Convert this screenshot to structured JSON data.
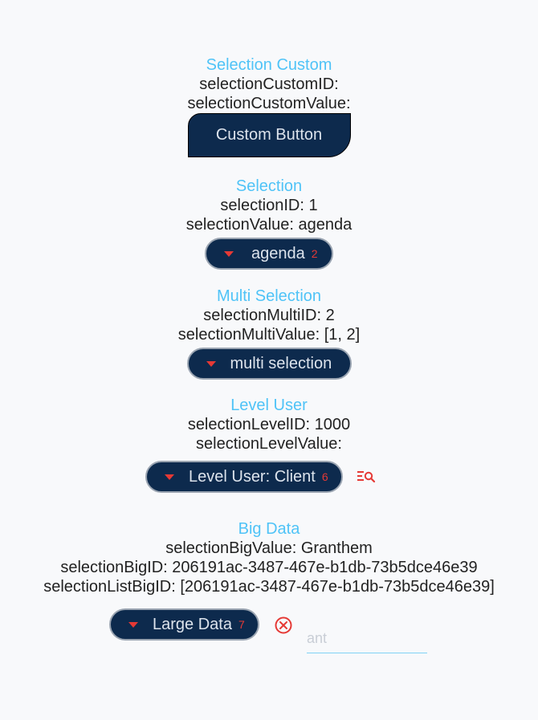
{
  "selection_custom": {
    "title": "Selection Custom",
    "id_line": "selectionCustomID:",
    "value_line": "selectionCustomValue:",
    "button_label": "Custom Button"
  },
  "selection": {
    "title": "Selection",
    "id_line": "selectionID: 1",
    "value_line": "selectionValue: agenda",
    "dropdown_label": "agenda",
    "badge": "2"
  },
  "multi_selection": {
    "title": "Multi Selection",
    "id_line": "selectionMultiID: 2",
    "value_line": "selectionMultiValue: [1, 2]",
    "dropdown_label": "multi selection"
  },
  "level_user": {
    "title": "Level User",
    "id_line": "selectionLevelID: 1000",
    "value_line": "selectionLevelValue:",
    "dropdown_label": "Level User: Client",
    "badge": "6",
    "side_icon": "search-list-icon"
  },
  "big_data": {
    "title": "Big Data",
    "value_line": "selectionBigValue: Granthem",
    "id_line": "selectionBigID: 206191ac-3487-467e-b1db-73b5dce46e39",
    "list_line": "selectionListBigID: [206191ac-3487-467e-b1db-73b5dce46e39]",
    "dropdown_label": "Large Data",
    "badge": "7",
    "clear_icon": "clear-circle-icon",
    "search_value": "ant"
  },
  "colors": {
    "title": "#4fc3f7",
    "pill_bg": "#0d2a4d",
    "accent_red": "#e53935"
  }
}
